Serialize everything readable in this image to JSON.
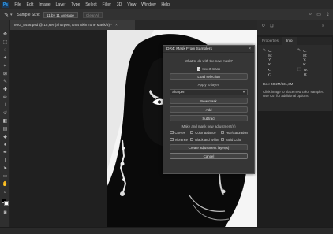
{
  "app": {
    "logo": "Ps"
  },
  "menu": [
    "File",
    "Edit",
    "Image",
    "Layer",
    "Type",
    "Select",
    "Filter",
    "3D",
    "View",
    "Window",
    "Help"
  ],
  "options_bar": {
    "sample_size_label": "Sample Size:",
    "sample_size_value": "11 by 11 Average",
    "clear_all_label": "Clear All"
  },
  "document_tab": {
    "title": "IMG_8446.psd @ 15,6% (Sharpen, DS4 Skin Tone Mask/8) *",
    "close": "×"
  },
  "panel": {
    "tabs": [
      "Properties",
      "Info"
    ],
    "active_tab": "Info",
    "readouts": [
      {
        "icon": "eyedropper-icon",
        "lines": "C:\nM:\nY:\nK:"
      },
      {
        "icon": "eyedropper-icon",
        "lines": "C:\nM:\nY:\nK:"
      },
      {
        "icon": "crosshair-icon",
        "lines": "X:\nY:"
      },
      {
        "icon": "marquee-icon",
        "lines": "W:\nH:"
      }
    ],
    "doc_info": "Doc: 40,2M/431,3M",
    "hint": "Click image to place new color sampler. Use Ctrl for additional options."
  },
  "dialog": {
    "title": "DR4: Mask From Samplers",
    "close": "×",
    "question": "What to do with the new mask?",
    "invert_label": "Invert mask",
    "invert_checked": true,
    "load_selection": "Load selection",
    "apply_section": "Apply to layer:",
    "layer_value": "Sharpen",
    "new_mask": "New mask",
    "add": "Add",
    "subtract": "Subtract",
    "adjust_section": "Make and mask new adjustment(s)",
    "adjustments": [
      {
        "label": "Curves",
        "checked": false
      },
      {
        "label": "Color Balance",
        "checked": false
      },
      {
        "label": "Hue/Saturation",
        "checked": false
      },
      {
        "label": "Vibrance",
        "checked": false
      },
      {
        "label": "Black and White",
        "checked": false
      },
      {
        "label": "Solid Color",
        "checked": false
      }
    ],
    "create_adjustments": "Create adjustment layer(s)",
    "cancel": "Cancel"
  },
  "colors": {
    "foreground": "#000000",
    "background": "#ffffff",
    "accent": "#31a8ff"
  }
}
